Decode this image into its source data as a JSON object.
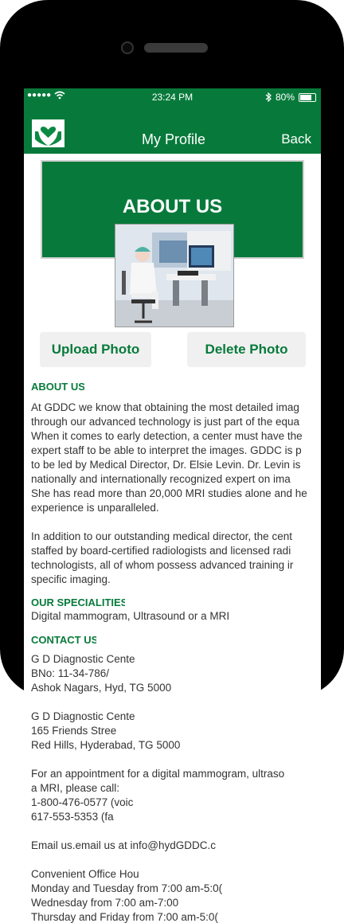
{
  "status_bar": {
    "signal": "●●●●●",
    "time": "23:24 PM",
    "battery": "80%",
    "battery_level": 0.8
  },
  "nav": {
    "title": "My Profile",
    "back_label": "Back"
  },
  "banner": {
    "heading": "ABOUT US"
  },
  "buttons": {
    "upload": "Upload Photo",
    "delete": "Delete Photo"
  },
  "about": {
    "title": "ABOUT US",
    "lines": [
      "At GDDC we know that obtaining the most detailed imag",
      "through our advanced technology is just part of the equa",
      "When it comes to early detection, a center must have the",
      "expert staff to be able to interpret the images. GDDC is p",
      "to be led by Medical Director, Dr. Elsie Levin. Dr. Levin is",
      "nationally and internationally recognized expert on  ima",
      "She has read more than 20,000 MRI studies alone and he",
      "experience is unparalleled.",
      "",
      "In addition to our outstanding medical director, the cent",
      "staffed by board-certified radiologists and licensed radi",
      "technologists, all of whom possess advanced training ir",
      "specific imaging."
    ]
  },
  "specialities": {
    "title": "OUR SPECIALITIES",
    "text": "Digital mammogram, Ultrasound or a MRI"
  },
  "contact": {
    "title": "CONTACT US",
    "lines": [
      "G D Diagnostic Cente",
      "BNo: 11-34-786/",
      "Ashok Nagars, Hyd, TG 5000",
      "",
      "G D Diagnostic Cente",
      "165 Friends Stree",
      "Red Hills, Hyderabad, TG 5000",
      "",
      "For an appointment for a digital mammogram, ultraso",
      "a  MRI, please call:",
      "1-800-476-0577 (voic",
      "617-553-5353 (fa",
      "",
      "Email us.email us at info@hydGDDC.c",
      "",
      "Convenient Office Hou",
      "Monday and Tuesday from 7:00 am-5:0(",
      "Wednesday from 7:00 am-7:00",
      "Thursday and Friday from 7:00 am-5:0("
    ]
  },
  "colors": {
    "brand_green": "#077a3b",
    "button_bg": "#f0f0f0"
  }
}
